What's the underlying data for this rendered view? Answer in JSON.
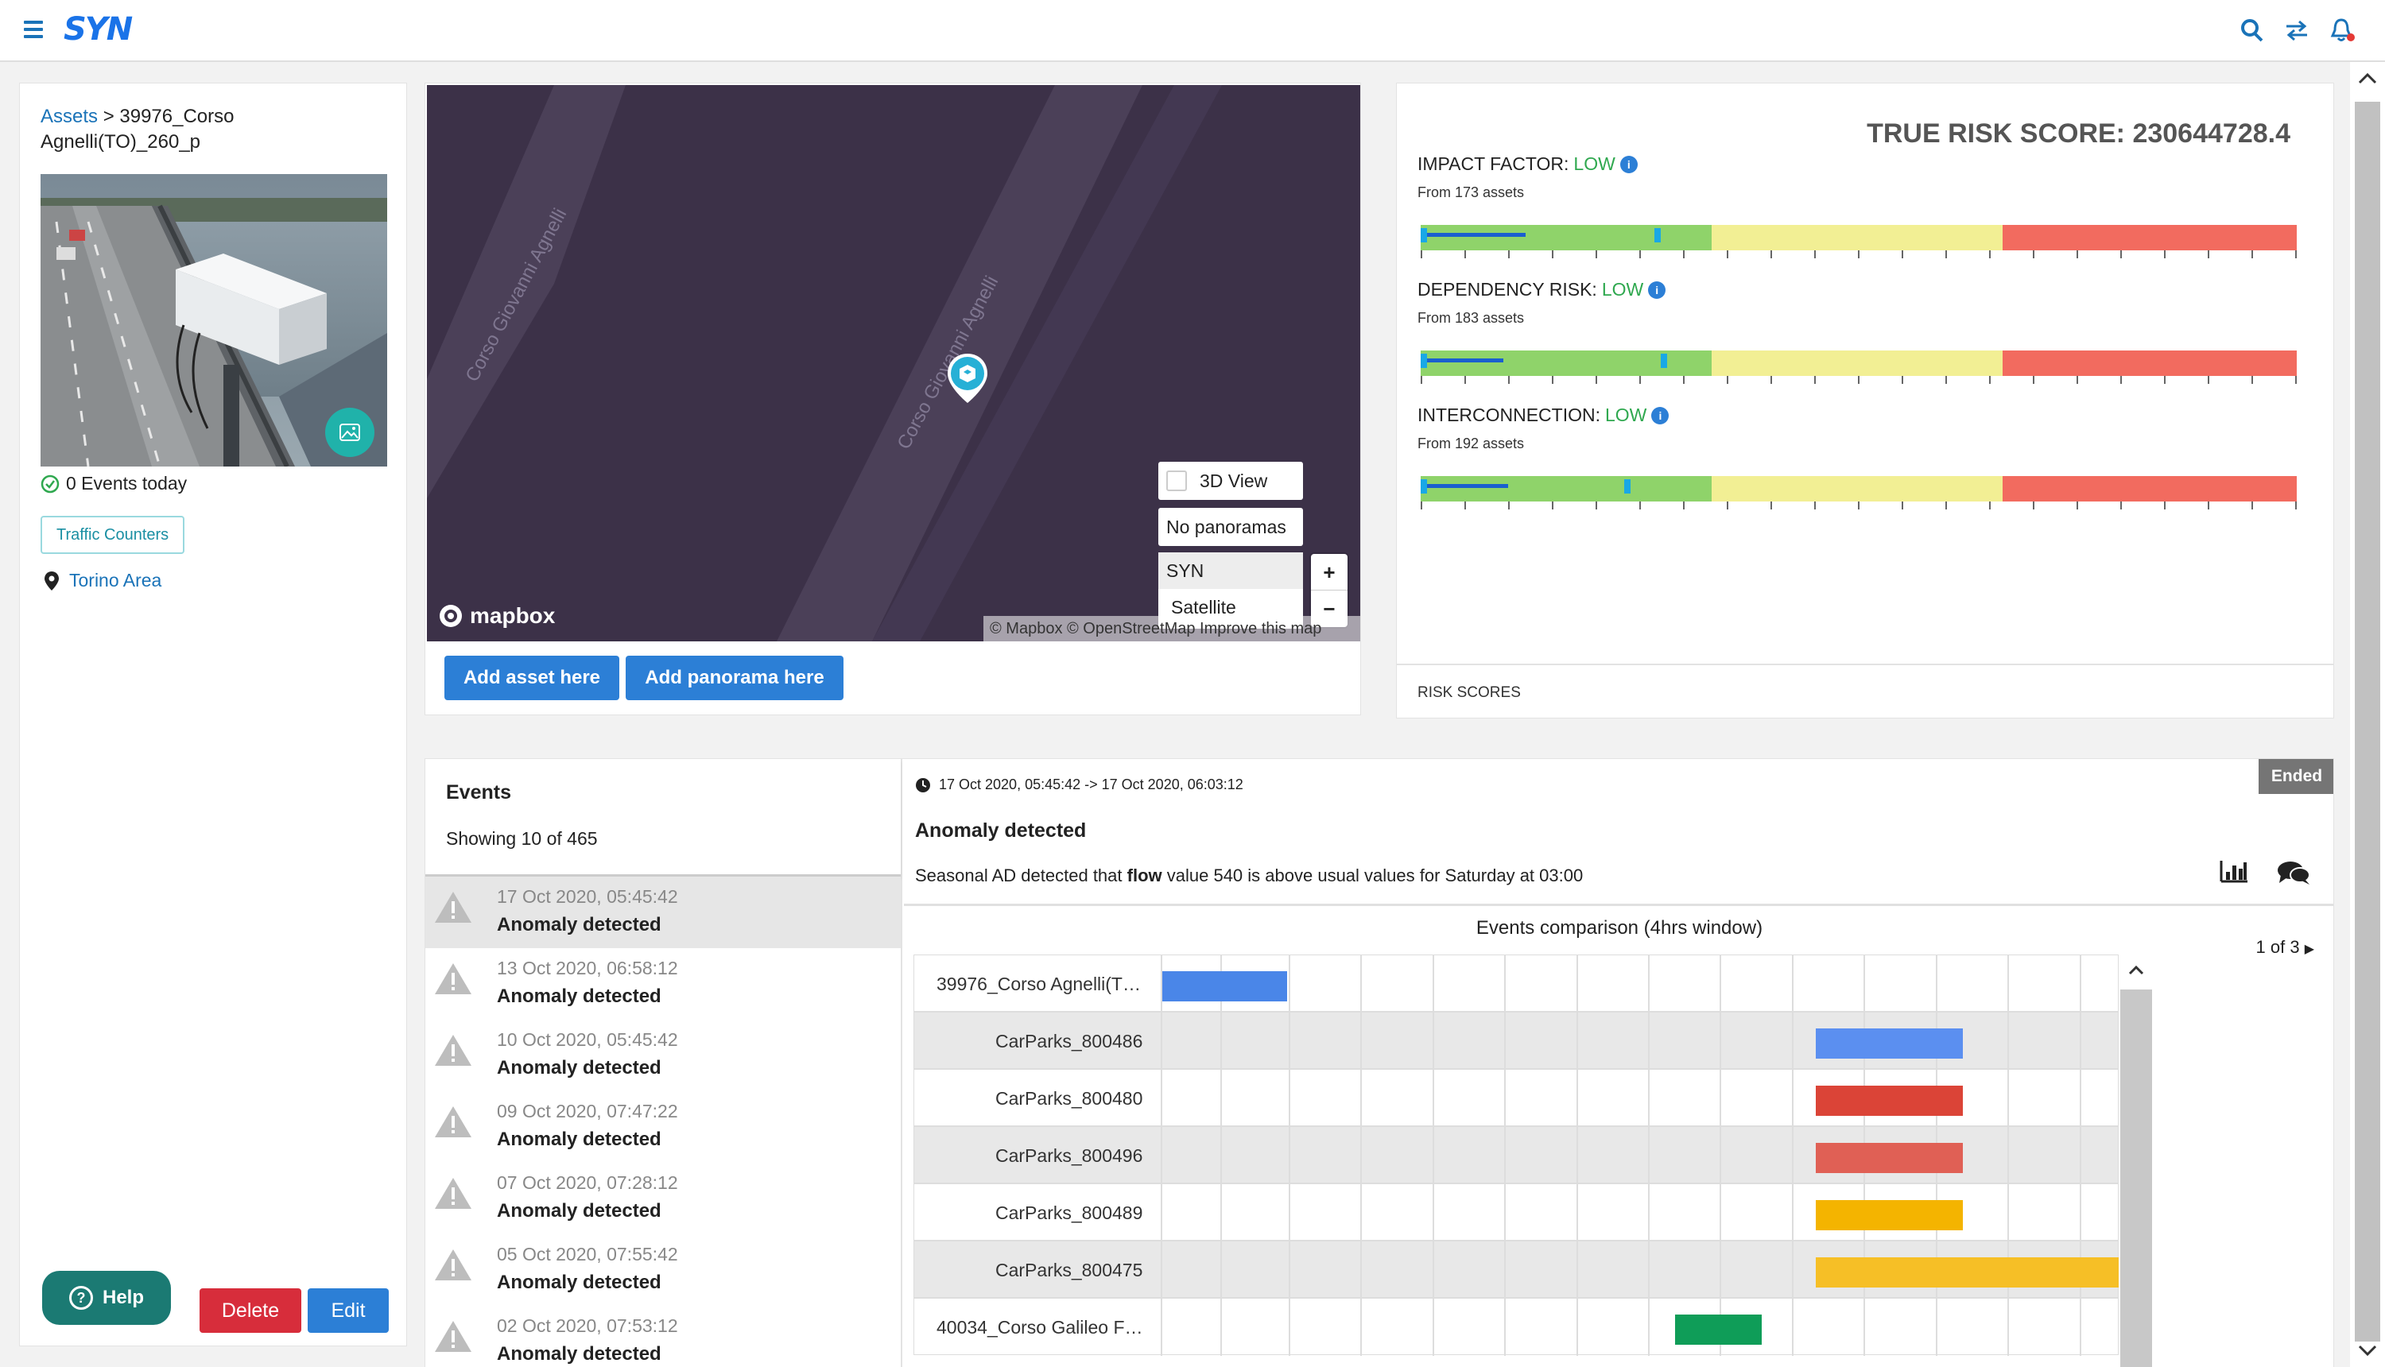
{
  "app": {
    "logo": "SYN"
  },
  "topbar": {
    "icons": [
      "menu-icon",
      "search-icon",
      "swap-icon",
      "bell-icon"
    ]
  },
  "asset": {
    "breadcrumb_link": "Assets",
    "breadcrumb_sep": ">",
    "name": "39976_Corso Agnelli(TO)_260_p",
    "events_today": "0 Events today",
    "tag": "Traffic Counters",
    "area": "Torino Area"
  },
  "left_actions": {
    "help": "Help",
    "delete": "Delete",
    "edit": "Edit"
  },
  "map": {
    "street1": "Corso Giovanni Agnelli",
    "street2": "Corso Giovanni Agnelli",
    "view3d": "3D View",
    "panoramas": "No panoramas",
    "style_syn": "SYN",
    "style_satellite": "Satellite",
    "zoom_in": "+",
    "zoom_out": "−",
    "attribution": "© Mapbox © OpenStreetMap  Improve this map",
    "logo": "mapbox",
    "add_asset": "Add asset here",
    "add_panorama": "Add panorama here"
  },
  "risk": {
    "true_risk_score": "TRUE RISK SCORE: 230644728.4",
    "footer": "RISK SCORES",
    "blocks": [
      {
        "label": "IMPACT FACTOR:",
        "level": "LOW",
        "from": "From 173 assets"
      },
      {
        "label": "DEPENDENCY RISK:",
        "level": "LOW",
        "from": "From 183 assets"
      },
      {
        "label": "INTERCONNECTION:",
        "level": "LOW",
        "from": "From 192 assets"
      }
    ],
    "colors": {
      "green": "#8fd36a",
      "yellow": "#f2ef94",
      "red": "#f26b5f",
      "low": "#2fa84f"
    }
  },
  "events": {
    "title": "Events",
    "showing": "Showing 10 of 465",
    "items": [
      {
        "date": "17 Oct 2020, 05:45:42",
        "type": "Anomaly detected"
      },
      {
        "date": "13 Oct 2020, 06:58:12",
        "type": "Anomaly detected"
      },
      {
        "date": "10 Oct 2020, 05:45:42",
        "type": "Anomaly detected"
      },
      {
        "date": "09 Oct 2020, 07:47:22",
        "type": "Anomaly detected"
      },
      {
        "date": "07 Oct 2020, 07:28:12",
        "type": "Anomaly detected"
      },
      {
        "date": "05 Oct 2020, 07:55:42",
        "type": "Anomaly detected"
      },
      {
        "date": "02 Oct 2020, 07:53:12",
        "type": "Anomaly detected"
      }
    ]
  },
  "detail": {
    "status": "Ended",
    "range": "17 Oct 2020, 05:45:42 -> 17 Oct 2020, 06:03:12",
    "title": "Anomaly detected",
    "desc_pre": "Seasonal AD detected that ",
    "desc_bold": "flow",
    "desc_post": " value 540 is above usual values for Saturday at 03:00",
    "comparison_title": "Events comparison (4hrs window)",
    "pager": "1 of 3",
    "rows": [
      {
        "label": "39976_Corso Agnelli(T…",
        "color": "#4a86e8"
      },
      {
        "label": "CarParks_800486",
        "color": "#5b8ff0"
      },
      {
        "label": "CarParks_800480",
        "color": "#db4437"
      },
      {
        "label": "CarParks_800496",
        "color": "#e06055"
      },
      {
        "label": "CarParks_800489",
        "color": "#f4b400"
      },
      {
        "label": "CarParks_800475",
        "color": "#f6bf26"
      },
      {
        "label": "40034_Corso Galileo F…",
        "color": "#0f9d58"
      }
    ]
  }
}
